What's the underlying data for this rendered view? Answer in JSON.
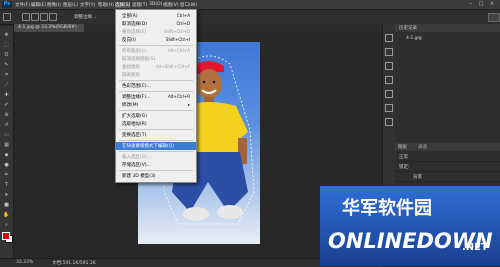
{
  "app": {
    "logo": "Ps"
  },
  "menubar": {
    "items": [
      "文件(F)",
      "编辑(E)",
      "图像(I)",
      "图层(L)",
      "文字(Y)",
      "选择(S)",
      "滤镜(T)",
      "3D(D)",
      "视图(V)",
      "窗口(W)",
      "帮助(H)"
    ]
  },
  "window_controls": [
    "–",
    "□",
    "×"
  ],
  "options": {
    "label": "调整边缘...",
    "icons": [
      "marquee-icon",
      "new-selection-icon",
      "add-selection-icon",
      "subtract-selection-icon",
      "intersect-selection-icon"
    ]
  },
  "document": {
    "tab": "4-1.jpg @ 33.3%(RGB/8#)",
    "zoom": "33.33%",
    "size": "文档:591.1K/591.1K"
  },
  "tools": [
    "move",
    "marquee",
    "lasso",
    "quick-select",
    "crop",
    "eyedropper",
    "spot-heal",
    "brush",
    "clone",
    "history-brush",
    "eraser",
    "gradient",
    "blur",
    "dodge",
    "pen",
    "type",
    "path-select",
    "shape",
    "hand",
    "zoom",
    "more"
  ],
  "colors": {
    "accent": "#3a7bd5",
    "foreground": "#dd0000",
    "background": "#ffffff"
  },
  "select_menu": {
    "items": [
      {
        "label": "全部(A)",
        "shortcut": "Ctrl+A",
        "disabled": false
      },
      {
        "label": "取消选择(D)",
        "shortcut": "Ctrl+D",
        "disabled": false
      },
      {
        "label": "重新选择(E)",
        "shortcut": "Shift+Ctrl+D",
        "disabled": true
      },
      {
        "label": "反向(I)",
        "shortcut": "Shift+Ctrl+I",
        "disabled": false
      },
      {
        "sep": true
      },
      {
        "label": "所有图层(L)",
        "shortcut": "Alt+Ctrl+A",
        "disabled": true
      },
      {
        "label": "取消选择图层(S)",
        "shortcut": "",
        "disabled": true
      },
      {
        "label": "查找图层",
        "shortcut": "Alt+Shift+Ctrl+F",
        "disabled": true
      },
      {
        "label": "隔离图层",
        "shortcut": "",
        "disabled": true
      },
      {
        "sep": true
      },
      {
        "label": "色彩范围(C)...",
        "shortcut": "",
        "disabled": false
      },
      {
        "sep": true
      },
      {
        "label": "调整边缘(F)...",
        "shortcut": "Alt+Ctrl+R",
        "disabled": false
      },
      {
        "label": "修改(M)",
        "shortcut": "▸",
        "disabled": false
      },
      {
        "sep": true
      },
      {
        "label": "扩大选取(G)",
        "shortcut": "",
        "disabled": false
      },
      {
        "label": "选取相似(R)",
        "shortcut": "",
        "disabled": false
      },
      {
        "sep": true
      },
      {
        "label": "变换选区(T)",
        "shortcut": "",
        "disabled": false
      },
      {
        "sep": true
      },
      {
        "label": "在快速蒙版模式下编辑(Q)",
        "shortcut": "",
        "disabled": false,
        "highlighted": true
      },
      {
        "sep": true
      },
      {
        "label": "载入选区(O)...",
        "shortcut": "",
        "disabled": true
      },
      {
        "label": "存储选区(V)...",
        "shortcut": "",
        "disabled": false
      },
      {
        "sep": true
      },
      {
        "label": "新建 3D 模型(3)",
        "shortcut": "",
        "disabled": false
      }
    ]
  },
  "history_panel": {
    "title": "历史记录",
    "entry": "4-1.jpg"
  },
  "layers_panel": {
    "tabs": [
      "图层",
      "通道"
    ],
    "rows": [
      "正常",
      "锁定:",
      "背景"
    ]
  },
  "watermark": {
    "brand": "华军软件园",
    "domain": "ONLINEDOWN",
    "tld": ".NET"
  }
}
